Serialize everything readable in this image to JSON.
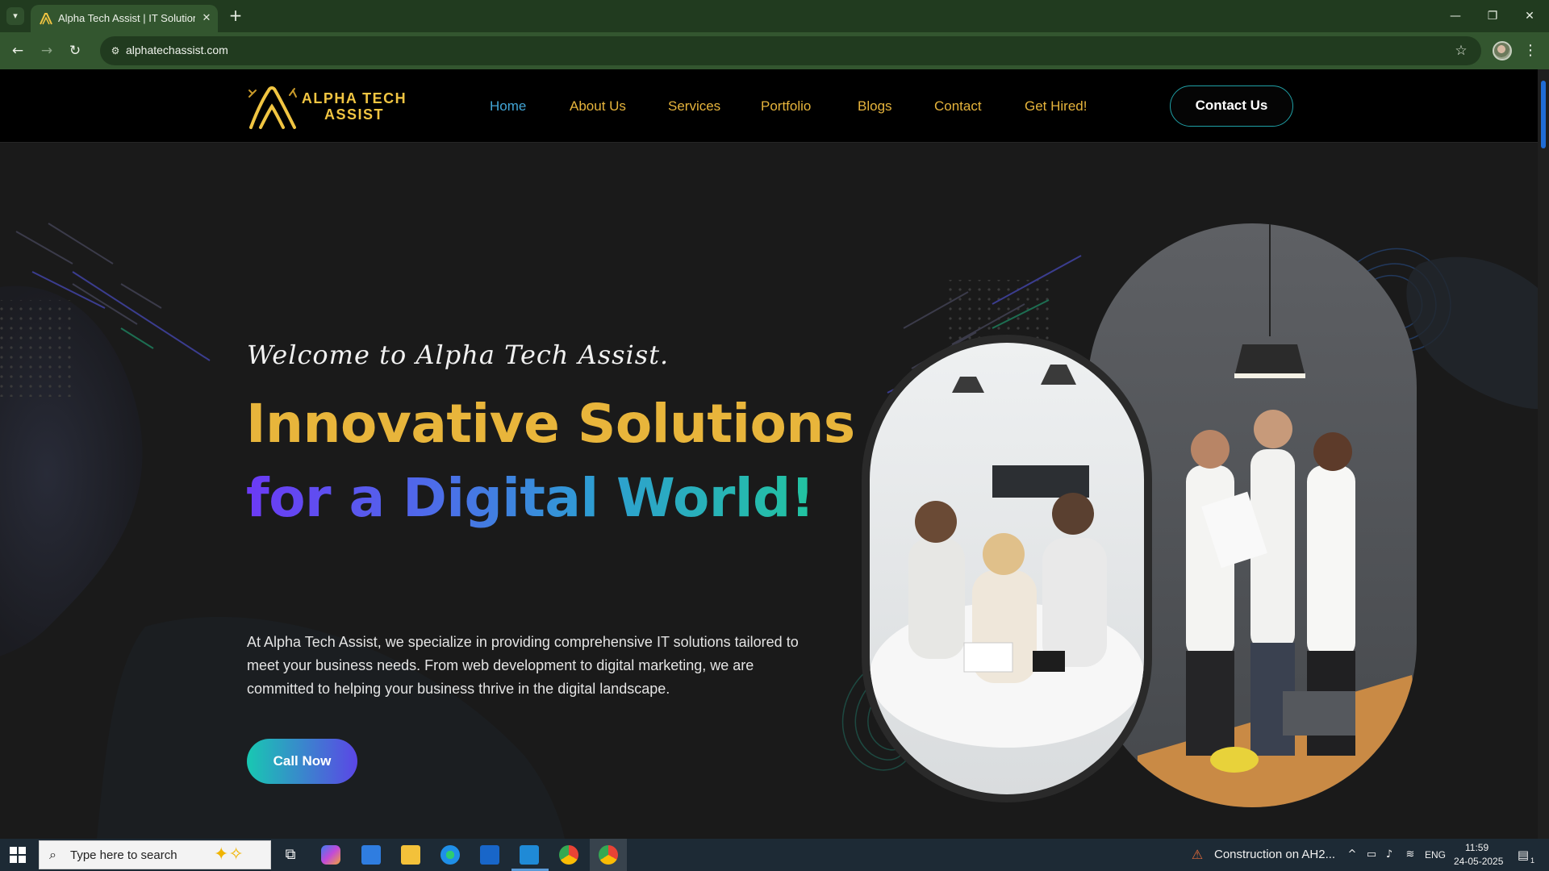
{
  "browser": {
    "tab_title": "Alpha Tech Assist | IT Solutions",
    "url": "alphatechassist.com"
  },
  "site": {
    "logo_line1": "ALPHA TECH",
    "logo_line2": "ASSIST",
    "nav": [
      {
        "label": "Home",
        "active": true
      },
      {
        "label": "About Us"
      },
      {
        "label": "Services"
      },
      {
        "label": "Portfolio"
      },
      {
        "label": "Blogs"
      },
      {
        "label": "Contact"
      },
      {
        "label": "Get Hired!"
      }
    ],
    "contact_button": "Contact Us"
  },
  "hero": {
    "welcome": "Welcome to Alpha Tech Assist.",
    "headline_line1": "Innovative Solutions",
    "headline_line2": "for a Digital World!",
    "intro": "At Alpha Tech Assist, we specialize in providing comprehensive IT solutions tailored to meet your business needs. From web development to digital marketing, we are committed to helping your business thrive in the digital landscape.",
    "call_button": "Call Now"
  },
  "taskbar": {
    "search_placeholder": "Type here to search",
    "news": "Construction on AH2...",
    "language": "ENG",
    "time": "11:59",
    "date": "24-05-2025",
    "notification_count": "1"
  },
  "colors": {
    "accent_gold": "#e8b53b",
    "accent_teal": "#1f9fa5",
    "active_link": "#42a5d6",
    "browser_frame": "#213b1f"
  }
}
